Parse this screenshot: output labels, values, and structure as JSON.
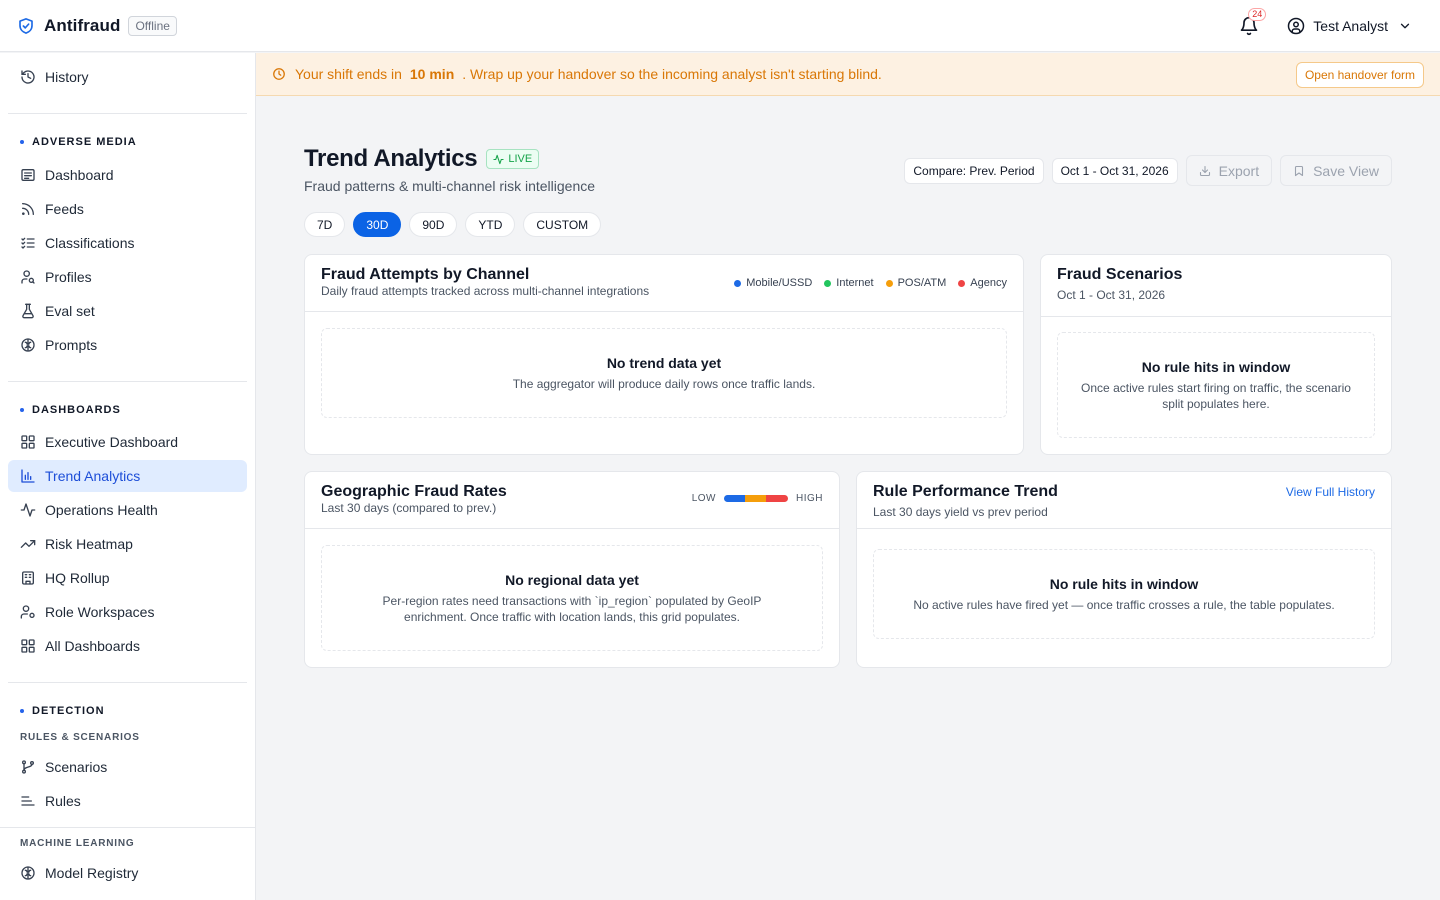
{
  "app": {
    "name": "Antifraud",
    "status": "Offline"
  },
  "header": {
    "notifications_count": "24",
    "user_name": "Test Analyst"
  },
  "sidebar": {
    "top": [
      {
        "label": "History",
        "icon": "history-icon"
      }
    ],
    "adverse_media": {
      "title": "ADVERSE MEDIA",
      "items": [
        {
          "label": "Dashboard",
          "icon": "dashboard-icon"
        },
        {
          "label": "Feeds",
          "icon": "rss-icon"
        },
        {
          "label": "Classifications",
          "icon": "list-check-icon"
        },
        {
          "label": "Profiles",
          "icon": "user-search-icon"
        },
        {
          "label": "Eval set",
          "icon": "flask-icon"
        },
        {
          "label": "Prompts",
          "icon": "brain-icon"
        }
      ]
    },
    "dashboards": {
      "title": "DASHBOARDS",
      "items": [
        {
          "label": "Executive Dashboard",
          "icon": "grid-icon"
        },
        {
          "label": "Trend Analytics",
          "icon": "bar-chart-icon"
        },
        {
          "label": "Operations Health",
          "icon": "activity-icon"
        },
        {
          "label": "Risk Heatmap",
          "icon": "trending-up-icon"
        },
        {
          "label": "HQ Rollup",
          "icon": "building-icon"
        },
        {
          "label": "Role Workspaces",
          "icon": "user-cog-icon"
        },
        {
          "label": "All Dashboards",
          "icon": "grid-icon"
        }
      ]
    },
    "detection": {
      "title": "DETECTION",
      "rules_heading": "RULES & SCENARIOS",
      "rules_items": [
        {
          "label": "Scenarios",
          "icon": "git-branch-icon"
        },
        {
          "label": "Rules",
          "icon": "list-filter-icon"
        }
      ],
      "ml_heading": "MACHINE LEARNING",
      "ml_items": [
        {
          "label": "Model Registry",
          "icon": "brain-icon"
        }
      ]
    }
  },
  "banner": {
    "prefix": "Your shift ends in",
    "time": "10 min",
    "suffix": ". Wrap up your handover so the incoming analyst isn't starting blind.",
    "button": "Open handover form"
  },
  "page": {
    "title": "Trend Analytics",
    "live_badge": "LIVE",
    "subtitle": "Fraud patterns & multi-channel risk intelligence",
    "compare": "Compare: Prev. Period",
    "date_range": "Oct 1 - Oct 31, 2026",
    "export": "Export",
    "save_view": "Save View",
    "ranges": [
      "7D",
      "30D",
      "90D",
      "YTD",
      "CUSTOM"
    ],
    "active_range": "30D"
  },
  "cards": {
    "channel": {
      "title": "Fraud Attempts by Channel",
      "subtitle": "Daily fraud attempts tracked across multi-channel integrations",
      "legend": [
        {
          "label": "Mobile/USSD",
          "color": "#1d6ae5"
        },
        {
          "label": "Internet",
          "color": "#22c55e"
        },
        {
          "label": "POS/ATM",
          "color": "#f59e0b"
        },
        {
          "label": "Agency",
          "color": "#ef4444"
        }
      ],
      "empty_title": "No trend data yet",
      "empty_desc": "The aggregator will produce daily rows once traffic lands."
    },
    "scenarios": {
      "title": "Fraud Scenarios",
      "subtitle": "Oct 1 - Oct 31, 2026",
      "empty_title": "No rule hits in window",
      "empty_desc": "Once active rules start firing on traffic, the scenario split populates here."
    },
    "geo": {
      "title": "Geographic Fraud Rates",
      "subtitle": "Last 30 days (compared to prev.)",
      "scale_low": "LOW",
      "scale_high": "HIGH",
      "empty_title": "No regional data yet",
      "empty_desc": "Per-region rates need transactions with `ip_region` populated by GeoIP enrichment. Once traffic with location lands, this grid populates."
    },
    "rules": {
      "title": "Rule Performance Trend",
      "subtitle": "Last 30 days yield vs prev period",
      "link": "View Full History",
      "empty_title": "No rule hits in window",
      "empty_desc": "No active rules have fired yet — once traffic crosses a rule, the table populates."
    }
  }
}
